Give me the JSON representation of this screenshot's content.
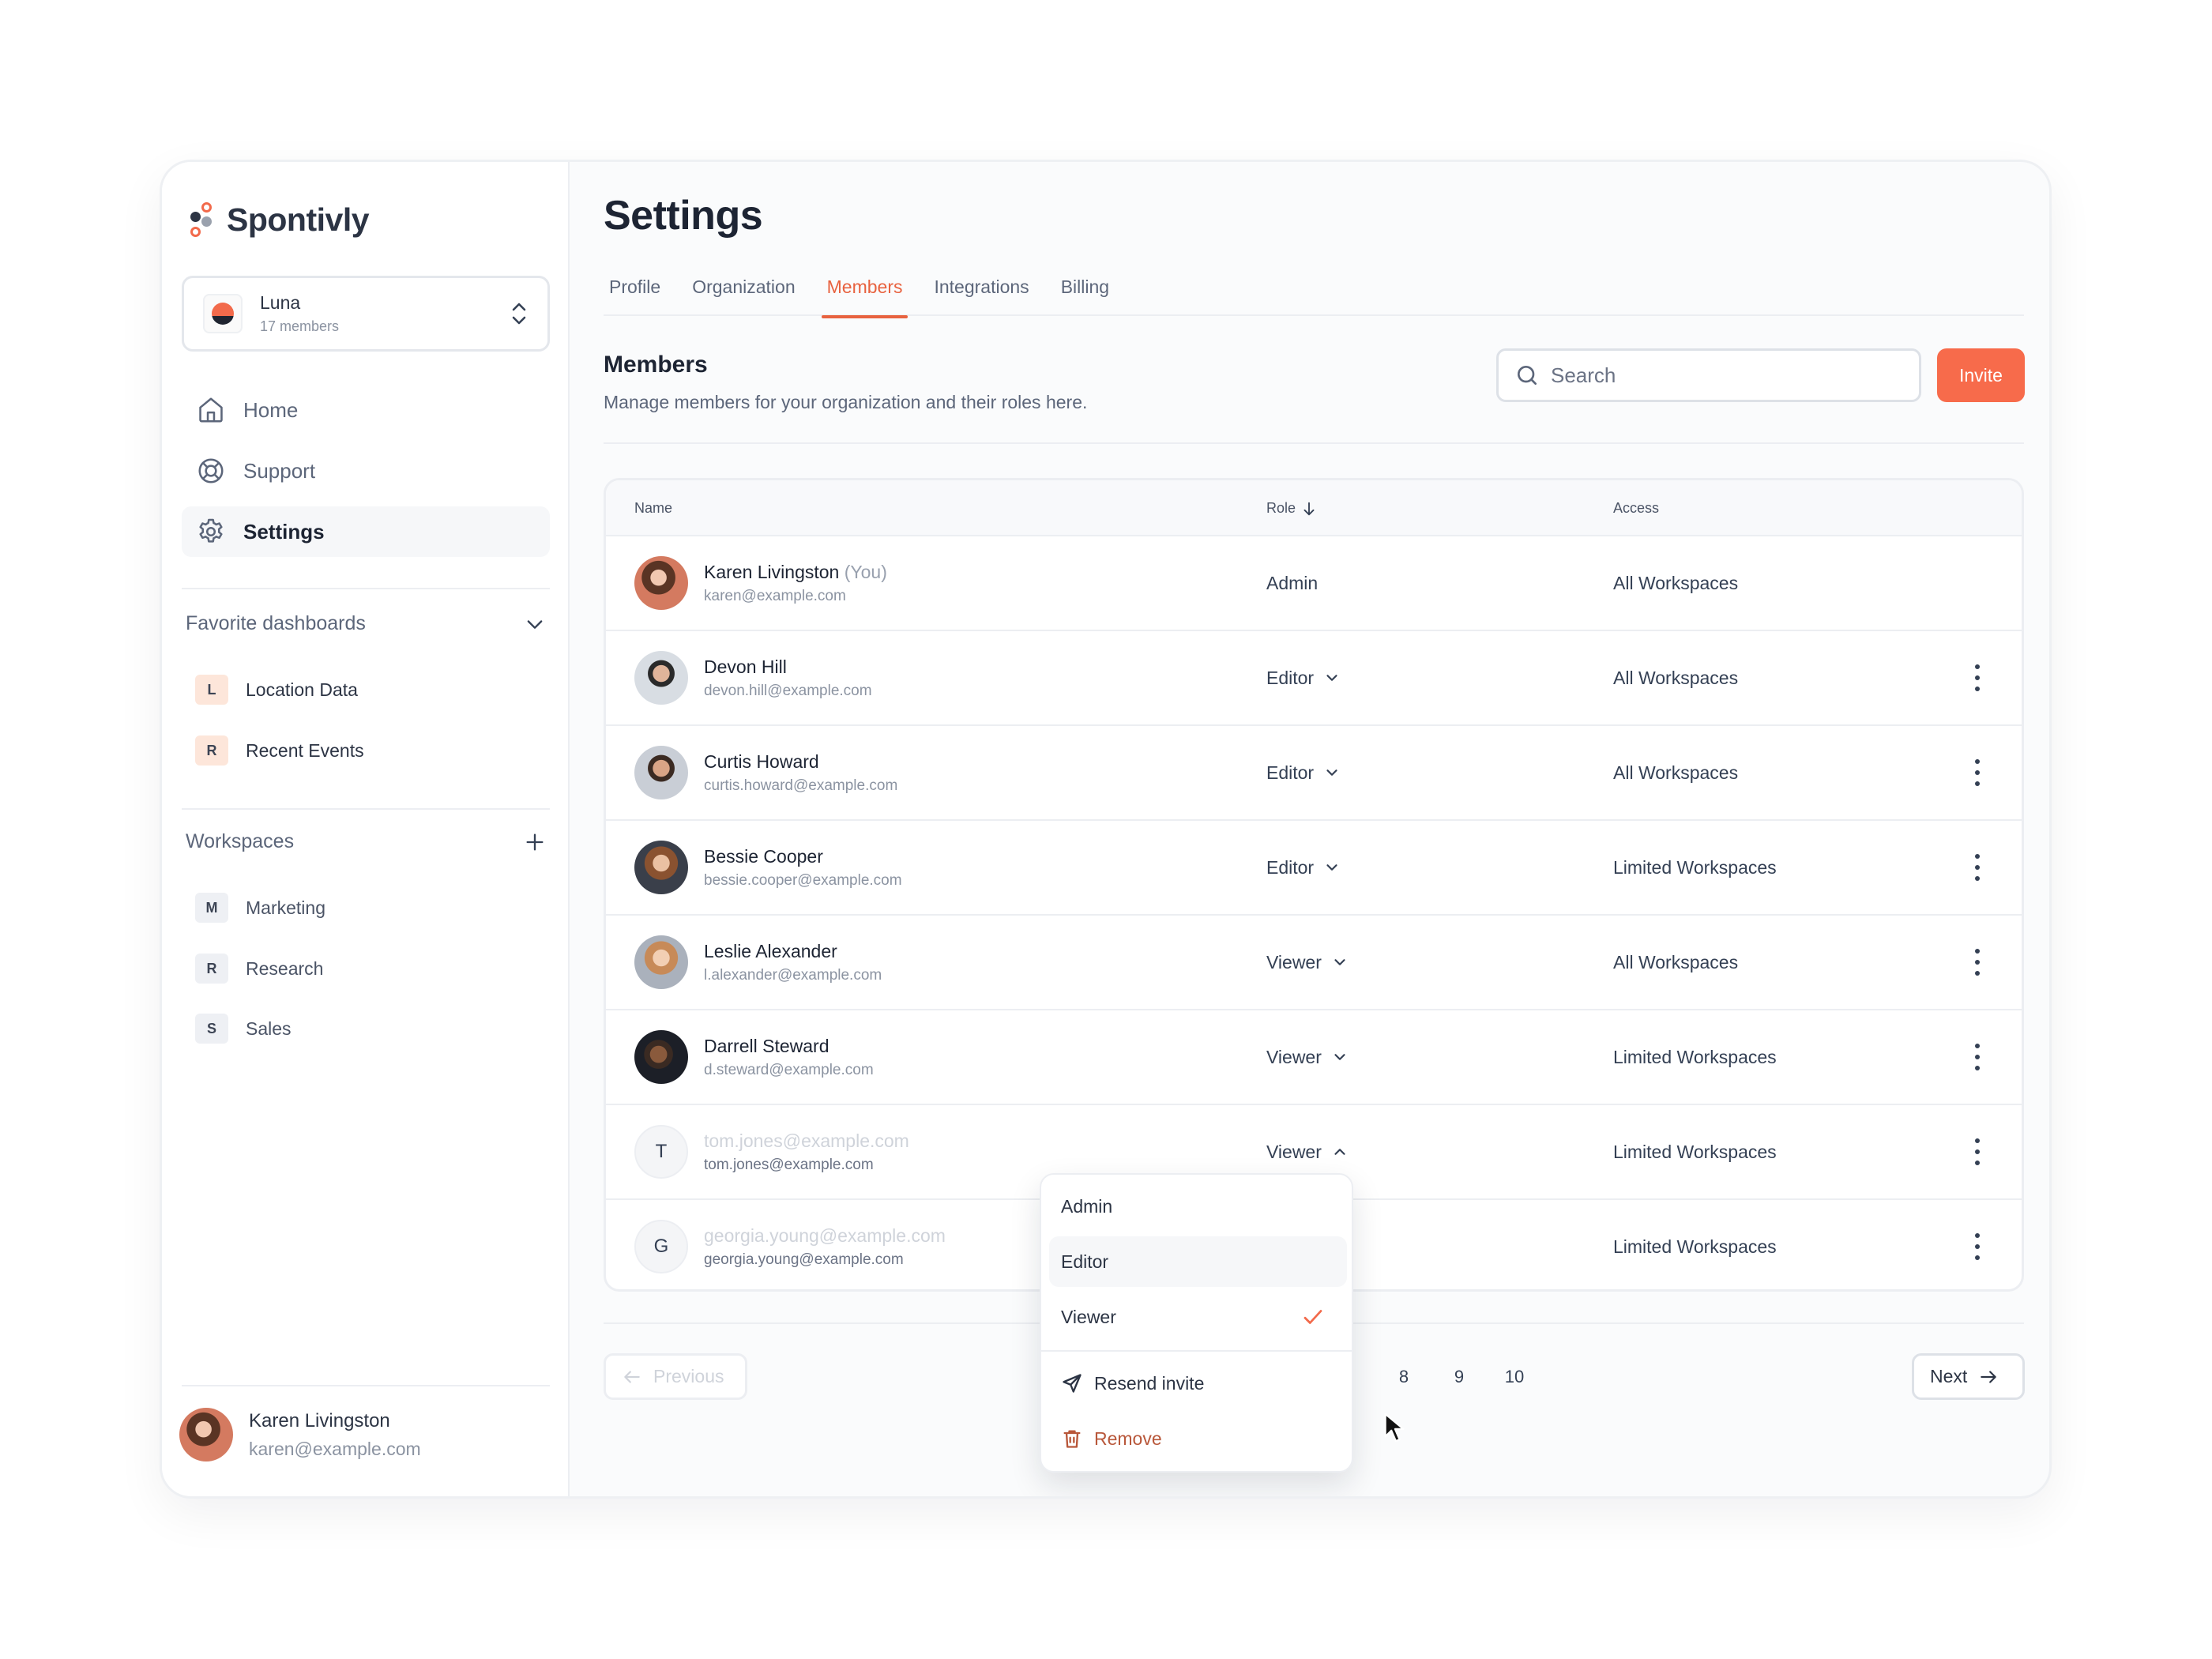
{
  "app": {
    "brand": "Spontivly"
  },
  "org_switcher": {
    "name": "Luna",
    "members": "17 members"
  },
  "nav": [
    {
      "label": "Home",
      "icon": "home-icon",
      "active": false
    },
    {
      "label": "Support",
      "icon": "lifebuoy-icon",
      "active": false
    },
    {
      "label": "Settings",
      "icon": "gear-icon",
      "active": true
    }
  ],
  "favorites": {
    "title": "Favorite dashboards",
    "items": [
      {
        "initial": "L",
        "label": "Location Data"
      },
      {
        "initial": "R",
        "label": "Recent Events"
      }
    ]
  },
  "workspaces": {
    "title": "Workspaces",
    "items": [
      {
        "initial": "M",
        "label": "Marketing"
      },
      {
        "initial": "R",
        "label": "Research"
      },
      {
        "initial": "S",
        "label": "Sales"
      }
    ]
  },
  "current_user": {
    "name": "Karen Livingston",
    "email": "karen@example.com"
  },
  "page": {
    "title": "Settings",
    "tabs": [
      {
        "label": "Profile",
        "active": false
      },
      {
        "label": "Organization",
        "active": false
      },
      {
        "label": "Members",
        "active": true
      },
      {
        "label": "Integrations",
        "active": false
      },
      {
        "label": "Billing",
        "active": false
      }
    ],
    "section_title": "Members",
    "section_desc": "Manage members for your organization and their roles here.",
    "search_placeholder": "Search",
    "invite_label": "Invite"
  },
  "table": {
    "columns": {
      "name": "Name",
      "role": "Role",
      "access": "Access"
    },
    "rows": [
      {
        "name": "Karen Livingston",
        "you": "(You)",
        "email": "karen@example.com",
        "role": "Admin",
        "access": "All Workspaces"
      },
      {
        "name": "Devon Hill",
        "email": "devon.hill@example.com",
        "role": "Editor",
        "access": "All Workspaces"
      },
      {
        "name": "Curtis Howard",
        "email": "curtis.howard@example.com",
        "role": "Editor",
        "access": "All Workspaces"
      },
      {
        "name": "Bessie Cooper",
        "email": "bessie.cooper@example.com",
        "role": "Editor",
        "access": "Limited Workspaces"
      },
      {
        "name": "Leslie Alexander",
        "email": "l.alexander@example.com",
        "role": "Viewer",
        "access": "All Workspaces"
      },
      {
        "name": "Darrell Steward",
        "email": "d.steward@example.com",
        "role": "Viewer",
        "access": "Limited Workspaces"
      },
      {
        "initial": "T",
        "name": "tom.jones@example.com",
        "email": "tom.jones@example.com",
        "role": "Viewer",
        "access": "Limited Workspaces",
        "pending": true
      },
      {
        "initial": "G",
        "name": "georgia.young@example.com",
        "email": "georgia.young@example.com",
        "role": "",
        "access": "Limited Workspaces",
        "pending": true
      }
    ]
  },
  "role_menu": {
    "options": [
      "Admin",
      "Editor",
      "Viewer"
    ],
    "selected": "Viewer",
    "hovered": "Editor",
    "resend_label": "Resend invite",
    "remove_label": "Remove"
  },
  "pagination": {
    "previous": "Previous",
    "next": "Next",
    "pages": [
      "8",
      "9",
      "10"
    ]
  },
  "colors": {
    "accent": "#f76b4b",
    "danger": "#b8573a"
  }
}
